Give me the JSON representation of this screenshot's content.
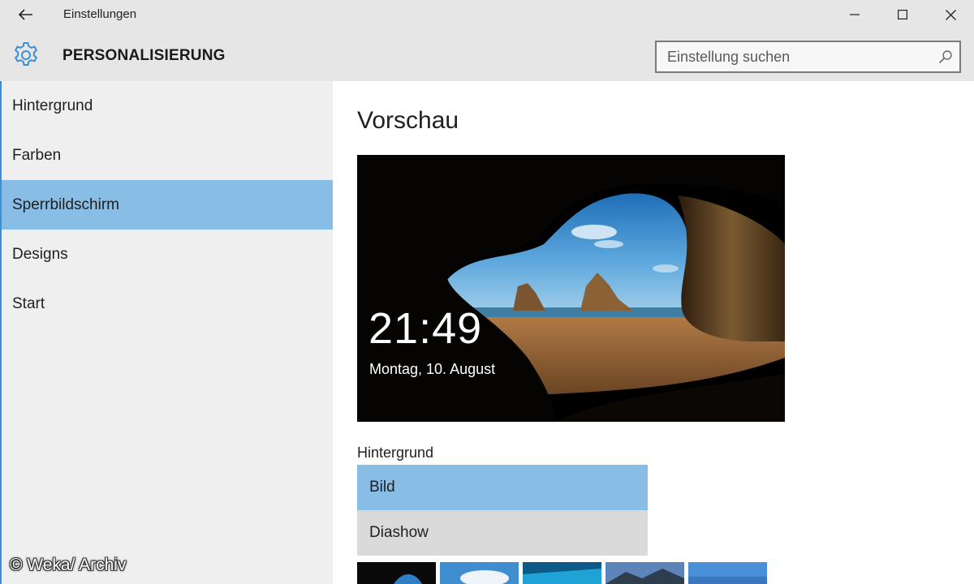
{
  "window": {
    "title": "Einstellungen",
    "back_icon": "back-arrow-icon",
    "controls": [
      "minimize-icon",
      "maximize-icon",
      "close-icon"
    ]
  },
  "header": {
    "title": "PERSONALISIERUNG",
    "icon": "gear-icon",
    "search": {
      "placeholder": "Einstellung suchen",
      "value": ""
    }
  },
  "sidebar": {
    "items": [
      {
        "label": "Hintergrund",
        "active": false
      },
      {
        "label": "Farben",
        "active": false
      },
      {
        "label": "Sperrbildschirm",
        "active": true
      },
      {
        "label": "Designs",
        "active": false
      },
      {
        "label": "Start",
        "active": false
      }
    ]
  },
  "main": {
    "title": "Vorschau",
    "preview": {
      "time": "21:49",
      "date": "Montag, 10. August"
    },
    "background_label": "Hintergrund",
    "options": [
      {
        "label": "Bild",
        "selected": true
      },
      {
        "label": "Diashow",
        "selected": false
      }
    ]
  },
  "watermark": "© Weka/ Archiv",
  "colors": {
    "accent": "#88bde6",
    "titlebar": "#e6e6e6",
    "sidebar": "#efefef",
    "gear": "#3b8fd6"
  }
}
